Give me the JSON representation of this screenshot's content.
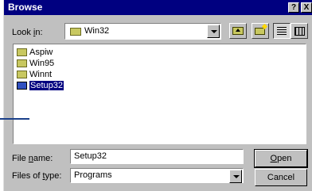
{
  "window": {
    "title": "Browse",
    "help_glyph": "?",
    "close_glyph": "X"
  },
  "toolbar": {
    "look_in_label": "Look in:",
    "look_in_mnemonic": "i",
    "look_in_value": "Win32"
  },
  "files": [
    {
      "name": "Aspiw",
      "type": "folder",
      "selected": false
    },
    {
      "name": "Win95",
      "type": "folder",
      "selected": false
    },
    {
      "name": "Winnt",
      "type": "folder",
      "selected": false
    },
    {
      "name": "Setup32",
      "type": "program",
      "selected": true
    }
  ],
  "file_name": {
    "label": "File name:",
    "mnemonic": "n",
    "value": "Setup32"
  },
  "files_of_type": {
    "label": "Files of type:",
    "mnemonic": "t",
    "value": "Programs"
  },
  "buttons": {
    "open": "Open",
    "cancel": "Cancel"
  },
  "colors": {
    "titlebar": "#000080",
    "dialog_bg": "#c0c0c0",
    "selection": "#000080"
  }
}
